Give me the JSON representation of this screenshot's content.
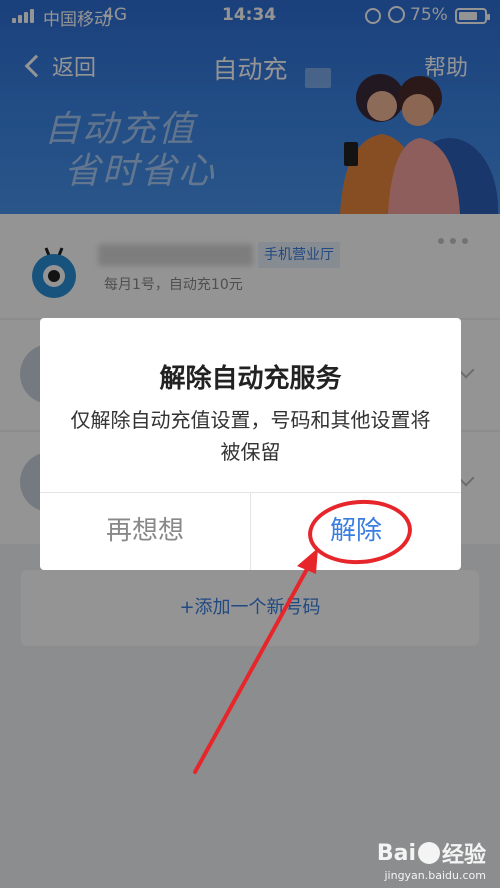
{
  "status_bar": {
    "carrier": "中国移动",
    "network": "4G",
    "time": "14:34",
    "battery": "75%",
    "battery_level": 0.75
  },
  "nav": {
    "back_label": "返回",
    "title": "自动充",
    "help_label": "帮助"
  },
  "banner": {
    "slogan_line1": "自动充值",
    "slogan_line2": "省时省心"
  },
  "list": {
    "items": [
      {
        "source": "手机营业厅",
        "desc": "每月1号，自动充10元"
      }
    ],
    "add_label": "+添加一个新号码"
  },
  "dialog": {
    "title": "解除自动充服务",
    "message": "仅解除自动充值设置，号码和其他设置将被保留",
    "cancel_label": "再想想",
    "confirm_label": "解除"
  },
  "watermark": {
    "brand": "Bai",
    "brand_suffix": "经验",
    "url": "jingyan.baidu.com"
  },
  "colors": {
    "accent": "#3a7ee0",
    "banner": "#2f6fd6",
    "annotation": "#e6262b"
  }
}
